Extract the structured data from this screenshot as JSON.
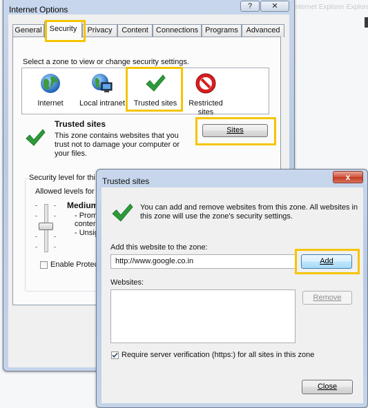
{
  "background": {
    "blurred_text": "Internet Explorer Explorer"
  },
  "internet_options": {
    "title": "Internet Options",
    "help_label": "?",
    "close_label": "✕",
    "tabs": [
      "General",
      "Security",
      "Privacy",
      "Content",
      "Connections",
      "Programs",
      "Advanced"
    ],
    "active_tab": "Security",
    "zone_prompt": "Select a zone to view or change security settings.",
    "zones": [
      {
        "name": "Internet",
        "icon": "globe-icon"
      },
      {
        "name": "Local intranet",
        "icon": "intranet-icon"
      },
      {
        "name": "Trusted sites",
        "icon": "checkmark-icon"
      },
      {
        "name": "Restricted sites",
        "icon": "restricted-icon"
      }
    ],
    "zone_detail": {
      "title": "Trusted sites",
      "description_lines": [
        "This zone contains websites that you",
        "trust not to damage your computer or",
        "your files."
      ]
    },
    "sites_button": "Sites",
    "security_level_label": "Security level for thi",
    "allowed_levels_label": "Allowed levels for",
    "level_name": "Medium",
    "level_bullets": [
      "- Prom",
      "conter",
      "- Unsig"
    ],
    "enable_protected_label": "Enable Protec"
  },
  "trusted_sites_dialog": {
    "title": "Trusted sites",
    "close_label": "x",
    "info_lines": [
      "You can add and remove websites from this zone. All websites in",
      "this zone will use the zone's security settings."
    ],
    "add_label": "Add this website to the zone:",
    "url_value": "http://www.google.co.in",
    "add_button": "Add",
    "websites_label": "Websites:",
    "remove_button": "Remove",
    "require_https_label": "Require server verification (https:) for all sites in this zone",
    "require_https_checked": true,
    "close_button": "Close"
  },
  "colors": {
    "highlight": "#f5c400",
    "check_green": "#2e9b3a",
    "restricted_red": "#d61f1f"
  }
}
